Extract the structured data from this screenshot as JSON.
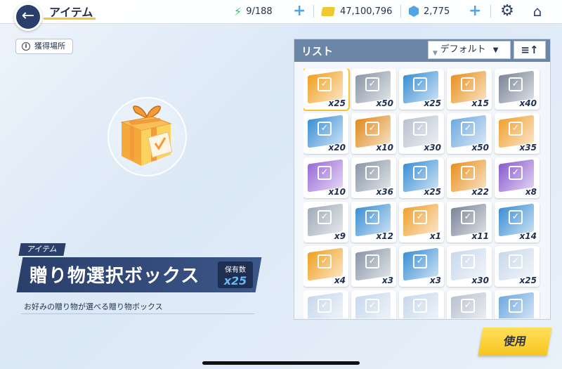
{
  "header": {
    "title": "アイテム",
    "stamina": "9/188",
    "gold": "47,100,796",
    "gems": "2,775",
    "plus_glyph": "+"
  },
  "acquire_label": "獲得場所",
  "item": {
    "category": "アイテム",
    "name": "贈り物選択ボックス",
    "owned_label": "保有数",
    "owned_value": "x25",
    "description": "お好みの贈り物が選べる贈り物ボックス"
  },
  "list": {
    "title": "リスト",
    "sort_label": "デフォルト",
    "cells": [
      {
        "count": "x25",
        "color": "#f0a020",
        "selected": true
      },
      {
        "count": "x50",
        "color": "#8a96a8",
        "selected": false
      },
      {
        "count": "x25",
        "color": "#3b8fd4",
        "selected": false
      },
      {
        "count": "x15",
        "color": "#e8901e",
        "selected": false
      },
      {
        "count": "x40",
        "color": "#7a8598",
        "selected": false
      },
      {
        "count": "x20",
        "color": "#3b8fd4",
        "selected": false
      },
      {
        "count": "x10",
        "color": "#e08a1e",
        "selected": false
      },
      {
        "count": "x30",
        "color": "#b8c2d0",
        "selected": false
      },
      {
        "count": "x50",
        "color": "#6ea8e0",
        "selected": false
      },
      {
        "count": "x35",
        "color": "#f0a030",
        "selected": false
      },
      {
        "count": "x10",
        "color": "#9a6ad8",
        "selected": false
      },
      {
        "count": "x36",
        "color": "#8a96a8",
        "selected": false
      },
      {
        "count": "x25",
        "color": "#3b8fd4",
        "selected": false
      },
      {
        "count": "x22",
        "color": "#e8901e",
        "selected": false
      },
      {
        "count": "x8",
        "color": "#8a5ad0",
        "selected": false
      },
      {
        "count": "x9",
        "color": "#a0aab8",
        "selected": false
      },
      {
        "count": "x12",
        "color": "#3b8fd4",
        "selected": false
      },
      {
        "count": "x1",
        "color": "#f0a030",
        "selected": false
      },
      {
        "count": "x11",
        "color": "#7a8598",
        "selected": false
      },
      {
        "count": "x14",
        "color": "#3b8fd4",
        "selected": false
      },
      {
        "count": "x4",
        "color": "#f0a020",
        "selected": false
      },
      {
        "count": "x3",
        "color": "#8a96a8",
        "selected": false
      },
      {
        "count": "x3",
        "color": "#3b8fd4",
        "selected": false
      },
      {
        "count": "x30",
        "color": "#c8d8ec",
        "selected": false
      },
      {
        "count": "x25",
        "color": "#c8d8ec",
        "selected": false
      },
      {
        "count": "",
        "color": "#c8d8ec",
        "selected": false
      },
      {
        "count": "",
        "color": "#c8d8ec",
        "selected": false
      },
      {
        "count": "",
        "color": "#c8d8ec",
        "selected": false
      },
      {
        "count": "",
        "color": "#b8c2d0",
        "selected": false
      },
      {
        "count": "",
        "color": "#6ea8e0",
        "selected": false
      }
    ]
  },
  "use_button": "使用",
  "colors": {
    "accent": "#2b3f6b",
    "highlight": "#f3c531",
    "list_header": "#6c86a8"
  }
}
